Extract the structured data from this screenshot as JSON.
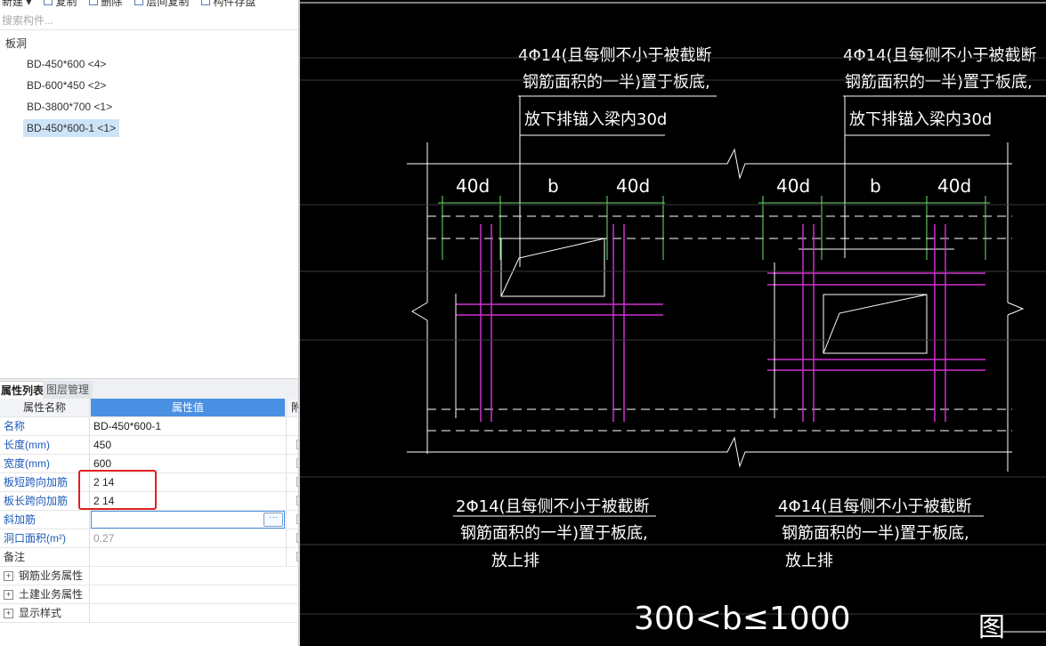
{
  "toolbar": {
    "new_label": "新建 ▾",
    "copy_label": "复制",
    "delete_label": "删除",
    "floor_copy_label": "层间复制",
    "save_label": "构件存盘"
  },
  "search": {
    "placeholder": "搜索构件..."
  },
  "tree": {
    "root": "板洞",
    "items": [
      "BD-450*600 <4>",
      "BD-600*450 <2>",
      "BD-3800*700 <1>",
      "BD-450*600-1 <1>"
    ]
  },
  "tabs": {
    "properties": "属性列表",
    "layers": "图层管理"
  },
  "props": {
    "header_name": "属性名称",
    "header_value": "属性值",
    "header_extra": "附",
    "rows": [
      {
        "name": "名称",
        "value": "BD-450*600-1"
      },
      {
        "name": "长度(mm)",
        "value": "450"
      },
      {
        "name": "宽度(mm)",
        "value": "600"
      },
      {
        "name": "板短跨向加筋",
        "value": "2 14"
      },
      {
        "name": "板长跨向加筋",
        "value": "2 14"
      },
      {
        "name": "斜加筋",
        "value": ""
      },
      {
        "name": "洞口面积(m²)",
        "value": "0.27"
      },
      {
        "name": "备注",
        "value": ""
      },
      {
        "name": "钢筋业务属性",
        "value": ""
      },
      {
        "name": "土建业务属性",
        "value": ""
      },
      {
        "name": "显示样式",
        "value": ""
      }
    ]
  },
  "drawing": {
    "note_top_left_1": "4Φ14(且每侧不小于被截断",
    "note_top_left_2": "钢筋面积的一半)置于板底,",
    "note_top_left_3": "放下排锚入梁内30d",
    "note_top_right_1": "4Φ14(且每侧不小于被截断",
    "note_top_right_2": "钢筋面积的一半)置于板底,",
    "note_top_right_3": "放下排锚入梁内30d",
    "dim_40d_1": "40d",
    "dim_b_1": "b",
    "dim_40d_2": "40d",
    "dim_40d_3": "40d",
    "dim_b_2": "b",
    "dim_40d_4": "40d",
    "note_bot_left_1": "2Φ14(且每侧不小于被截断",
    "note_bot_left_2": "钢筋面积的一半)置于板底,",
    "note_bot_left_3": "放上排",
    "note_bot_right_1": "4Φ14(且每侧不小于被截断",
    "note_bot_right_2": "钢筋面积的一半)置于板底,",
    "note_bot_right_3": "放上排",
    "formula": "300<b≤1000",
    "fig_label": "图"
  },
  "colors": {
    "cad_bg": "#000000",
    "green": "#6fe06f",
    "magenta": "#d030d0",
    "white": "#ffffff",
    "highlight": "#e02020"
  }
}
